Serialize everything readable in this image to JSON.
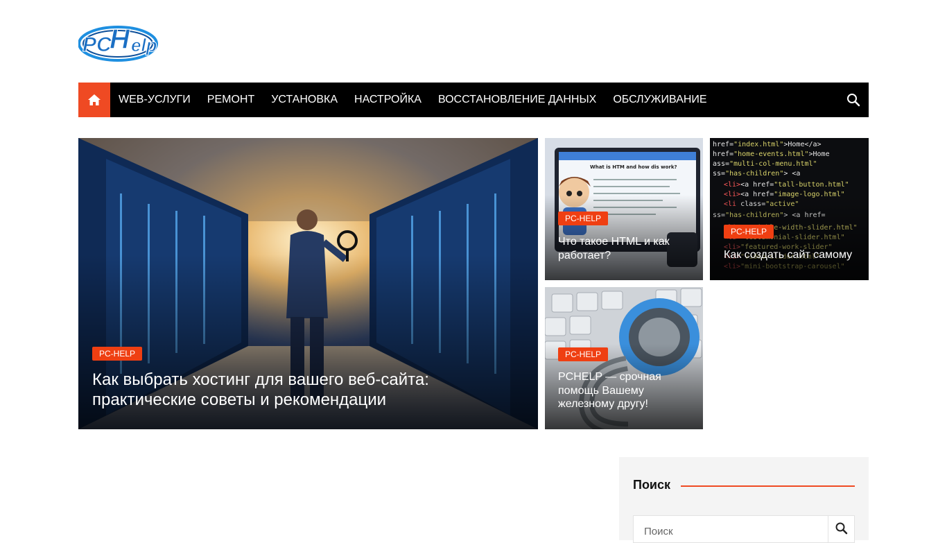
{
  "logo": {
    "text": "PCHelp",
    "colors": {
      "primary": "#1b6fc4",
      "ring": "#1e8fe0"
    }
  },
  "nav": {
    "home_icon": "home-icon",
    "items": [
      {
        "label": "WEB-УСЛУГИ"
      },
      {
        "label": "РЕМОНТ"
      },
      {
        "label": "УСТАНОВКА"
      },
      {
        "label": "НАСТРОЙКА"
      },
      {
        "label": "ВОССТАНОВЛЕНИЕ ДАННЫХ"
      },
      {
        "label": "ОБСЛУЖИВАНИЕ"
      }
    ],
    "search_icon": "search-icon"
  },
  "featured": [
    {
      "category": "PC-HELP",
      "title": "Как выбрать хостинг для вашего веб-сайта: практические советы и рекомендации"
    },
    {
      "category": "PC-HELP",
      "title": "Что такое HTML и как работает?"
    },
    {
      "category": "PC-HELP",
      "title": "Как создать сайт самому"
    },
    {
      "category": "PC-HELP",
      "title": "PCHELP — срочная помощь Вашему железному другу!"
    }
  ],
  "sidebar": {
    "search_title": "Поиск",
    "search_placeholder": "Поиск"
  },
  "colors": {
    "accent": "#ef4a23",
    "nav_bg": "#000000",
    "badge": "#ef3f12"
  }
}
